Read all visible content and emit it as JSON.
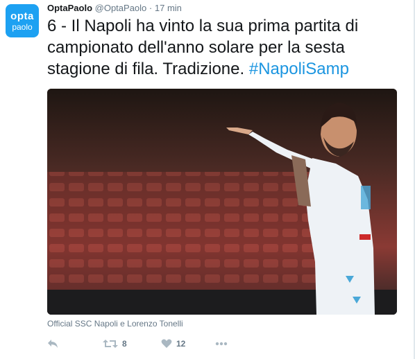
{
  "avatar": {
    "line1": "opta",
    "line2": "paolo"
  },
  "tweet": {
    "name": "OptaPaolo",
    "handle": "@OptaPaolo",
    "separator": "·",
    "time": "17 min",
    "text": "6 - Il Napoli ha vinto la sua prima partita di campionato dell'anno solare per la sesta stagione di fila. Tradizione.",
    "hashtag": "#NapoliSamp",
    "credit": "Official SSC Napoli e Lorenzo Tonelli",
    "retweet_count": "8",
    "like_count": "12"
  },
  "icons": {
    "reply": "reply-icon",
    "retweet": "retweet-icon",
    "like": "heart-icon",
    "more": "more-icon"
  },
  "colors": {
    "accent": "#1da1f2",
    "link": "#1b95e0",
    "muted": "#657786",
    "action_icon": "#aab8c2"
  }
}
